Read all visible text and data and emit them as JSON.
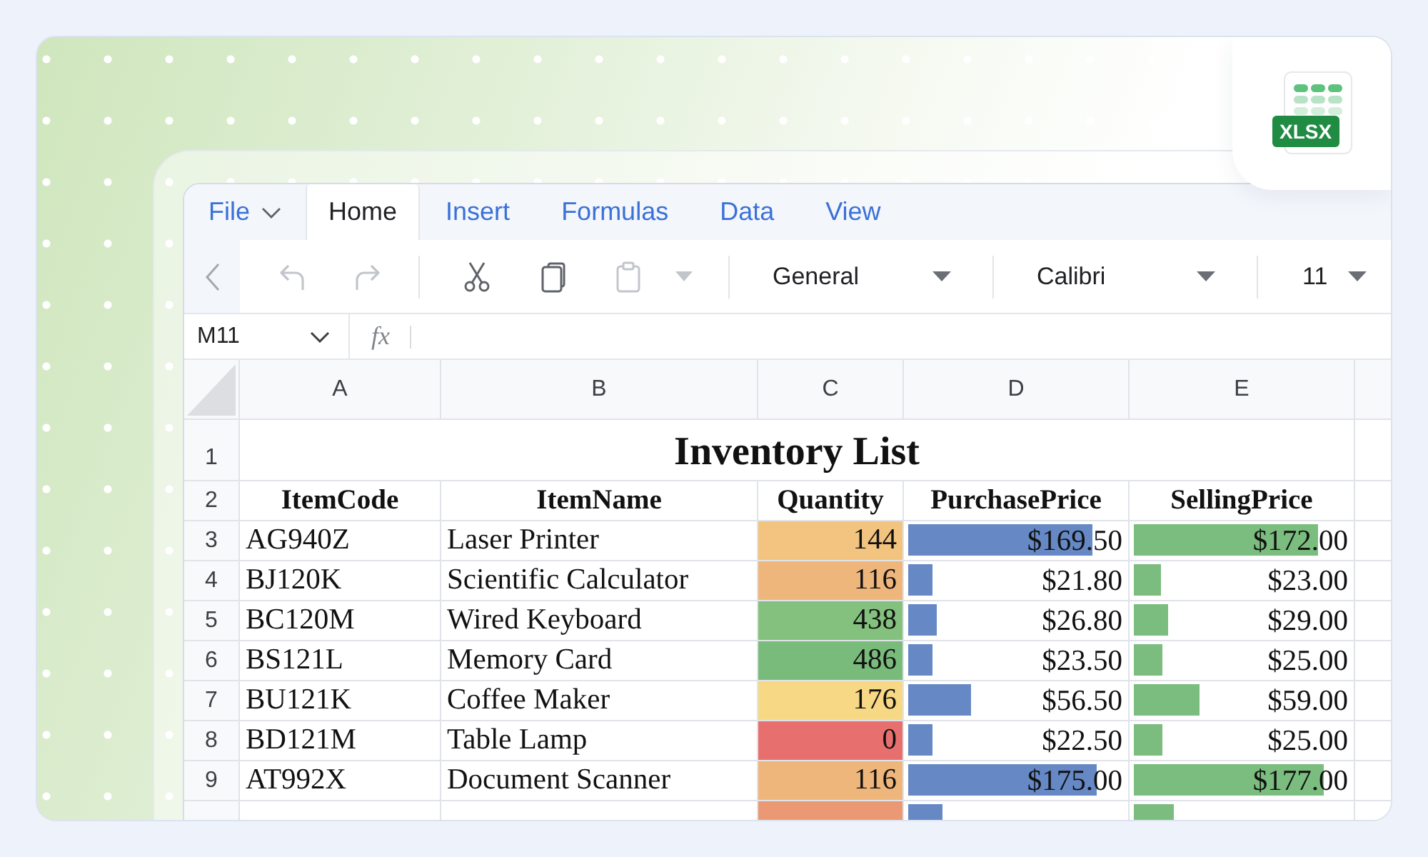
{
  "ribbon": {
    "file_menu": {
      "label": "File"
    },
    "tabs": [
      {
        "label": "Home",
        "selected": true
      },
      {
        "label": "Insert",
        "selected": false
      },
      {
        "label": "Formulas",
        "selected": false
      },
      {
        "label": "Data",
        "selected": false
      },
      {
        "label": "View",
        "selected": false
      }
    ]
  },
  "toolbar": {
    "button_groups": [
      [
        {
          "kind": "undo",
          "disabled": true
        },
        {
          "kind": "redo",
          "disabled": true
        }
      ],
      [
        {
          "kind": "cut",
          "disabled": false
        },
        {
          "kind": "copy",
          "disabled": false
        },
        {
          "kind": "paste",
          "disabled": true,
          "menu": true
        }
      ]
    ],
    "dropdowns": [
      {
        "value": "General"
      },
      {
        "value": "Calibri"
      },
      {
        "value": "11"
      }
    ]
  },
  "formula_bar": {
    "name_box": "M11",
    "function_label": "fx"
  },
  "sheet": {
    "column_headers": [
      "A",
      "B",
      "C",
      "D",
      "E"
    ],
    "title_row": {
      "number": "1",
      "text": "Inventory List"
    },
    "header_row": {
      "number": "2",
      "cells": [
        "ItemCode",
        "ItemName",
        "Quantity",
        "PurchasePrice",
        "SellingPrice"
      ]
    },
    "rows": [
      {
        "number": "3",
        "item_code": "AG940Z",
        "item_name": "Laser Printer",
        "quantity": {
          "text": "144",
          "color": "#f3c47f"
        },
        "purchase_price": {
          "text": "$169.50",
          "level": 0.82
        },
        "selling_price": {
          "text": "$172.00",
          "level": 0.82
        }
      },
      {
        "number": "4",
        "item_code": "BJ120K",
        "item_name": "Scientific Calculator",
        "quantity": {
          "text": "116",
          "color": "#efb67c"
        },
        "purchase_price": {
          "text": "$21.80",
          "level": 0.11
        },
        "selling_price": {
          "text": "$23.00",
          "level": 0.12
        }
      },
      {
        "number": "5",
        "item_code": "BC120M",
        "item_name": "Wired Keyboard",
        "quantity": {
          "text": "438",
          "color": "#84c07e"
        },
        "purchase_price": {
          "text": "$26.80",
          "level": 0.13
        },
        "selling_price": {
          "text": "$29.00",
          "level": 0.15
        }
      },
      {
        "number": "6",
        "item_code": "BS121L",
        "item_name": "Memory Card",
        "quantity": {
          "text": "486",
          "color": "#79bb7b"
        },
        "purchase_price": {
          "text": "$23.50",
          "level": 0.11
        },
        "selling_price": {
          "text": "$25.00",
          "level": 0.13
        }
      },
      {
        "number": "7",
        "item_code": "BU121K",
        "item_name": "Coffee Maker",
        "quantity": {
          "text": "176",
          "color": "#f7d884"
        },
        "purchase_price": {
          "text": "$56.50",
          "level": 0.28
        },
        "selling_price": {
          "text": "$59.00",
          "level": 0.29
        }
      },
      {
        "number": "8",
        "item_code": "BD121M",
        "item_name": "Table Lamp",
        "quantity": {
          "text": "0",
          "color": "#e7706e"
        },
        "purchase_price": {
          "text": "$22.50",
          "level": 0.11
        },
        "selling_price": {
          "text": "$25.00",
          "level": 0.13
        }
      },
      {
        "number": "9",
        "item_code": "AT992X",
        "item_name": "Document Scanner",
        "quantity": {
          "text": "116",
          "color": "#efb67c"
        },
        "purchase_price": {
          "text": "$175.00",
          "level": 0.84
        },
        "selling_price": {
          "text": "$177.00",
          "level": 0.85
        }
      },
      {
        "quantity": {
          "color": "#eb9874"
        },
        "purchase_price": {
          "level": 0.15
        },
        "selling_price": {
          "level": 0.18
        }
      }
    ]
  },
  "file_badge": {
    "label": "XLSX"
  }
}
